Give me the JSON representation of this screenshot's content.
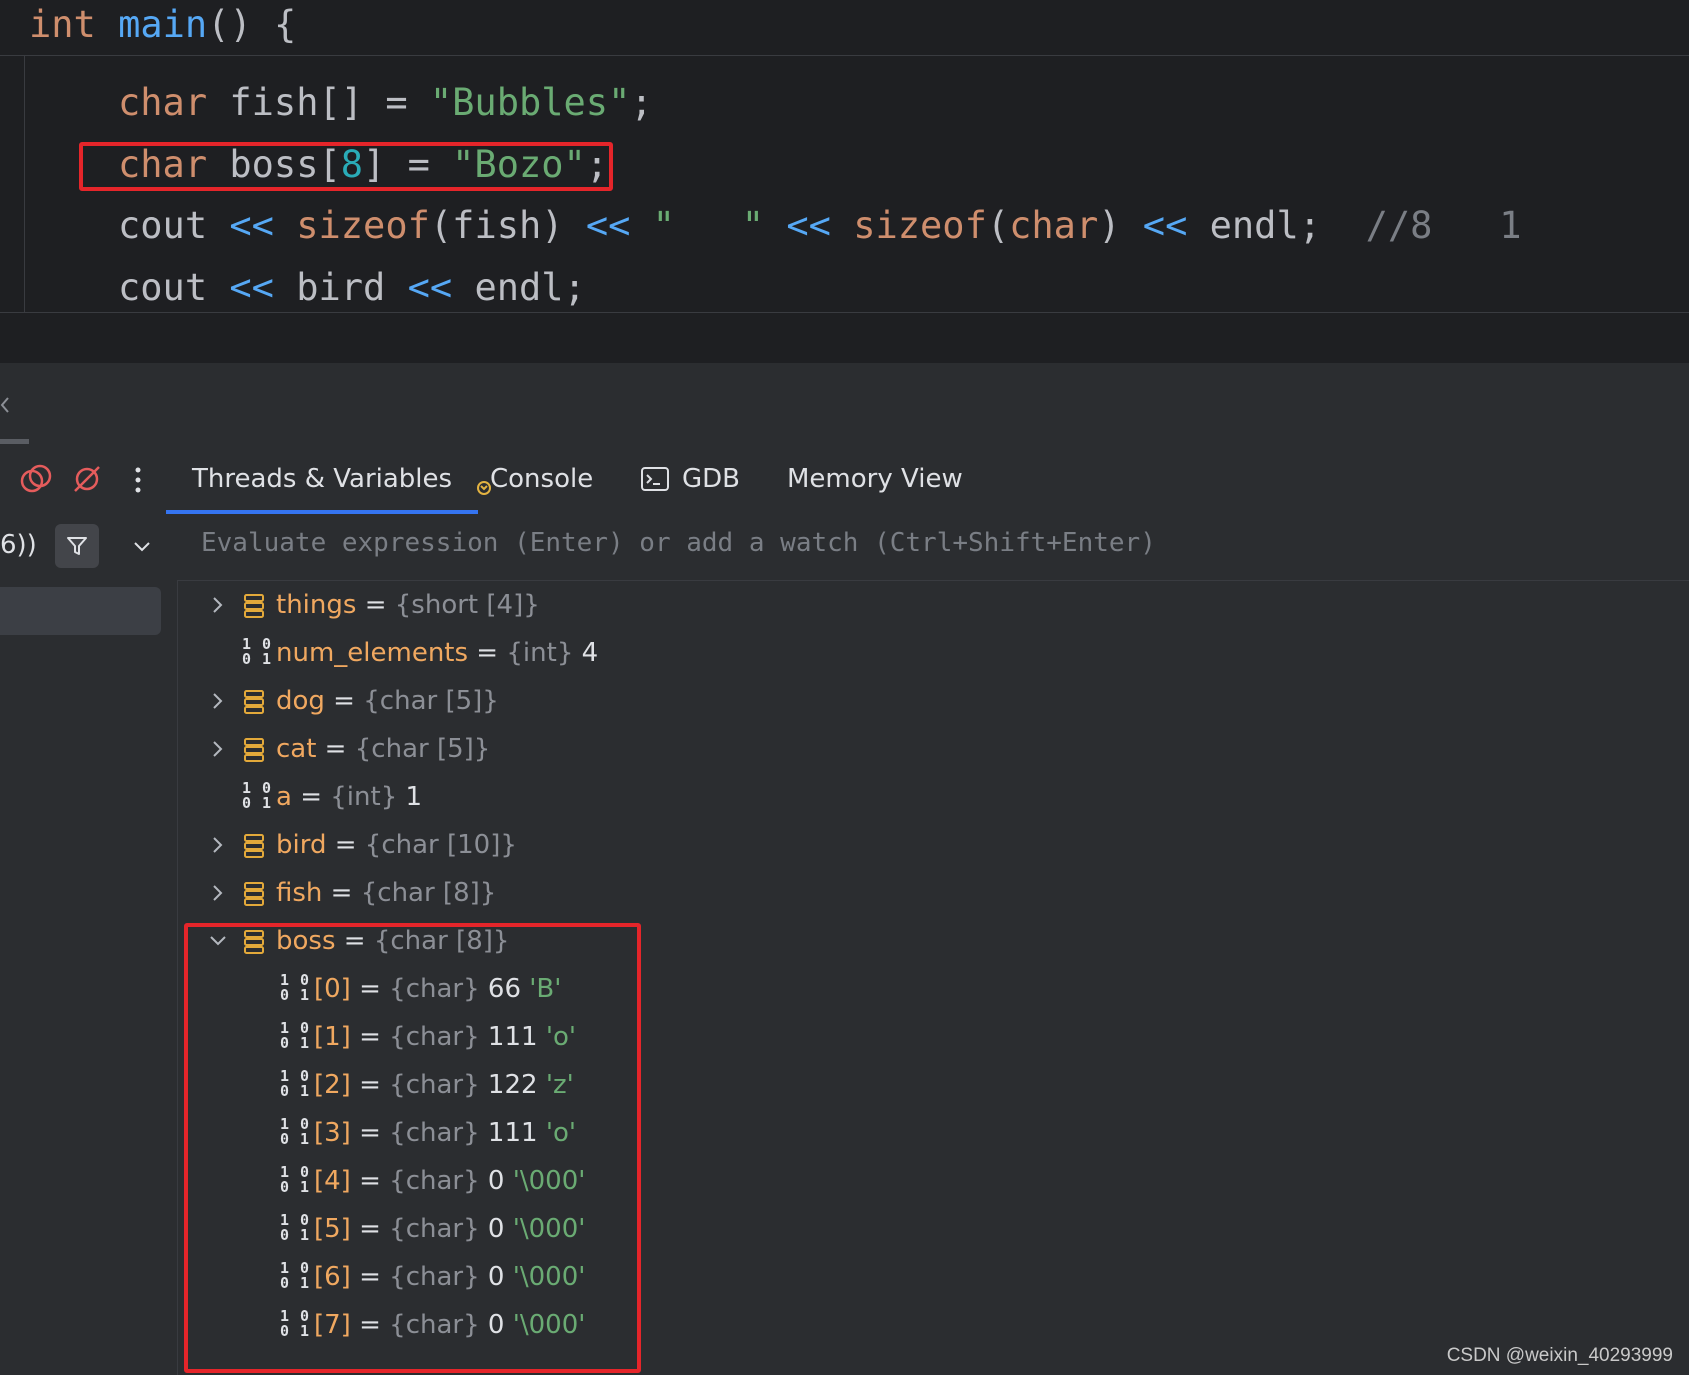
{
  "editor": {
    "header_line": {
      "kw": "int",
      "fn": "main",
      "rest": "() {"
    },
    "line1": {
      "kw": "char",
      "rest": " fish[] = ",
      "str": "\"Bubbles\"",
      "end": ";"
    },
    "line2": {
      "kw": "char",
      "rest_a": " boss[",
      "num": "8",
      "rest_b": "] = ",
      "str": "\"Bozo\"",
      "end": ";"
    },
    "line3": {
      "a": "cout ",
      "op1": "<<",
      "b": " ",
      "fn1": "sizeof",
      "c": "(fish) ",
      "op2": "<<",
      "d": " ",
      "str": "\"   \"",
      "e": " ",
      "op3": "<<",
      "f": " ",
      "fn2": "sizeof",
      "g": "(",
      "kw": "char",
      "h": ") ",
      "op4": "<<",
      "i": " endl;",
      "comment": "  //8   1"
    },
    "line4": {
      "a": "cout ",
      "op1": "<<",
      "b": " bird ",
      "op2": "<<",
      "c": " endl;"
    }
  },
  "debug_panel": {
    "left_partial_label": "6))",
    "tabs": [
      {
        "label": "Threads & Variables",
        "active": true
      },
      {
        "label": "Console",
        "active": false
      },
      {
        "label": "GDB",
        "active": false
      },
      {
        "label": "Memory View",
        "active": false
      }
    ],
    "evaluate_placeholder": "Evaluate expression (Enter) or add a watch (Ctrl+Shift+Enter)"
  },
  "variables": [
    {
      "name": "things",
      "type": "{short [4]}",
      "value": "",
      "str": "",
      "kind": "array",
      "expandable": true,
      "expanded": false
    },
    {
      "name": "num_elements",
      "type": "{int}",
      "value": "4",
      "str": "",
      "kind": "scalar",
      "expandable": false
    },
    {
      "name": "dog",
      "type": "{char [5]}",
      "value": "",
      "str": "",
      "kind": "array",
      "expandable": true,
      "expanded": false
    },
    {
      "name": "cat",
      "type": "{char [5]}",
      "value": "",
      "str": "",
      "kind": "array",
      "expandable": true,
      "expanded": false
    },
    {
      "name": "a",
      "type": "{int}",
      "value": "1",
      "str": "",
      "kind": "scalar",
      "expandable": false
    },
    {
      "name": "bird",
      "type": "{char [10]}",
      "value": "",
      "str": "",
      "kind": "array",
      "expandable": true,
      "expanded": false
    },
    {
      "name": "fish",
      "type": "{char [8]}",
      "value": "",
      "str": "",
      "kind": "array",
      "expandable": true,
      "expanded": false
    },
    {
      "name": "boss",
      "type": "{char [8]}",
      "value": "",
      "str": "",
      "kind": "array",
      "expandable": true,
      "expanded": true
    },
    {
      "name": "[0]",
      "type": "{char}",
      "value": "66",
      "str": "'B'",
      "kind": "scalar",
      "child": true
    },
    {
      "name": "[1]",
      "type": "{char}",
      "value": "111",
      "str": "'o'",
      "kind": "scalar",
      "child": true
    },
    {
      "name": "[2]",
      "type": "{char}",
      "value": "122",
      "str": "'z'",
      "kind": "scalar",
      "child": true
    },
    {
      "name": "[3]",
      "type": "{char}",
      "value": "111",
      "str": "'o'",
      "kind": "scalar",
      "child": true
    },
    {
      "name": "[4]",
      "type": "{char}",
      "value": "0",
      "str": "'\\000'",
      "kind": "scalar",
      "child": true
    },
    {
      "name": "[5]",
      "type": "{char}",
      "value": "0",
      "str": "'\\000'",
      "kind": "scalar",
      "child": true
    },
    {
      "name": "[6]",
      "type": "{char}",
      "value": "0",
      "str": "'\\000'",
      "kind": "scalar",
      "child": true
    },
    {
      "name": "[7]",
      "type": "{char}",
      "value": "0",
      "str": "'\\000'",
      "kind": "scalar",
      "child": true
    }
  ],
  "watermark": "CSDN @weixin_40293999",
  "colors": {
    "highlight": "#e5252a",
    "accent_tab": "#3574f0",
    "var_name": "#f0a860",
    "string": "#6aab73"
  }
}
